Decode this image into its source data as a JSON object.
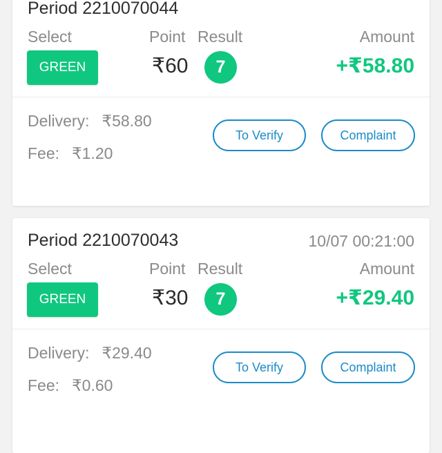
{
  "labels": {
    "select": "Select",
    "point": "Point",
    "result": "Result",
    "amount": "Amount",
    "delivery": "Delivery:",
    "fee": "Fee:",
    "to_verify": "To Verify",
    "complaint": "Complaint"
  },
  "colors": {
    "accent_green": "#10c77f",
    "link_blue": "#1a8bc9"
  },
  "records": [
    {
      "period": "Period 2210070044",
      "time": "",
      "select": "GREEN",
      "point": "₹60",
      "result": "7",
      "amount": "+₹58.80",
      "delivery": "₹58.80",
      "fee": "₹1.20"
    },
    {
      "period": "Period 2210070043",
      "time": "10/07 00:21:00",
      "select": "GREEN",
      "point": "₹30",
      "result": "7",
      "amount": "+₹29.40",
      "delivery": "₹29.40",
      "fee": "₹0.60"
    }
  ]
}
